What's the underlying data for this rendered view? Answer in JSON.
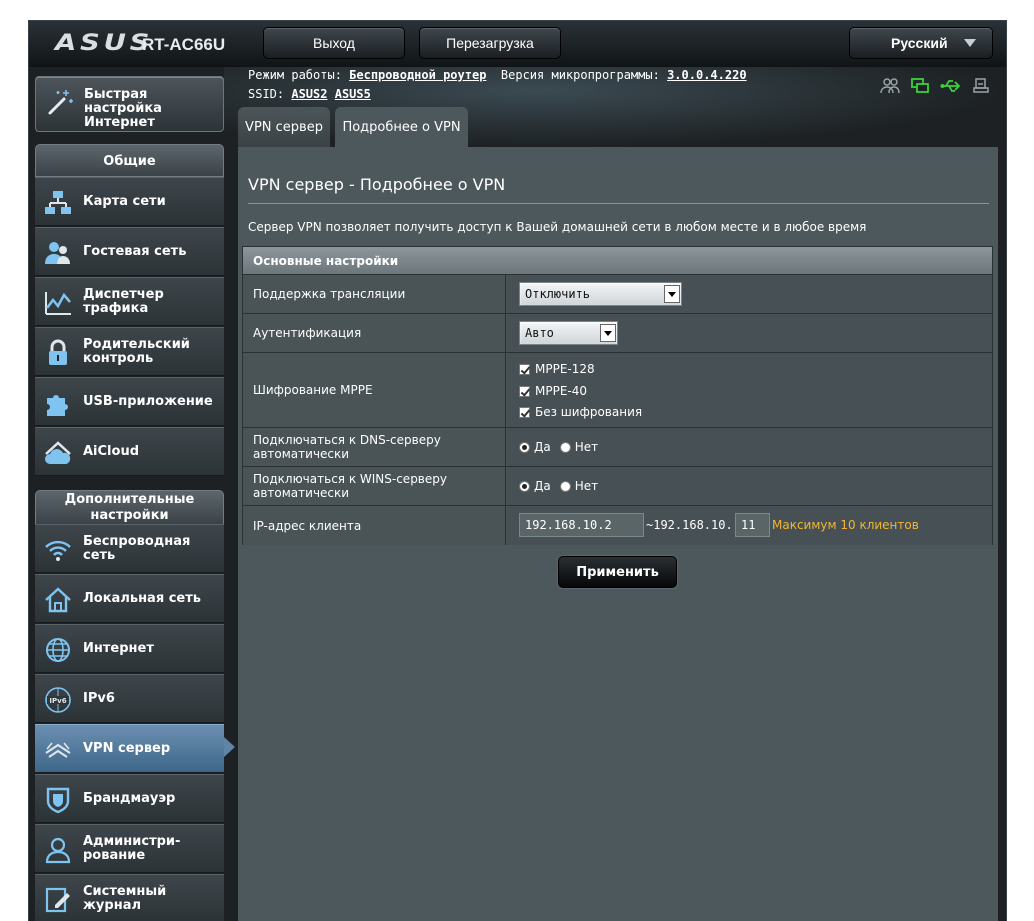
{
  "header": {
    "logo": "ASUS",
    "model": "RT-AC66U",
    "logout_label": "Выход",
    "reboot_label": "Перезагрузка",
    "language": "Русский"
  },
  "info": {
    "mode_label": "Режим работы:",
    "mode_value": "Беспроводной роутер",
    "fw_label": "Версия микропрограммы:",
    "fw_value": "3.0.0.4.220",
    "ssid_label": "SSID:",
    "ssid_1": "ASUS2",
    "ssid_2": "ASUS5"
  },
  "status_icons": [
    "clients-icon",
    "network-connected-icon",
    "usb-icon",
    "printer-icon"
  ],
  "sidebar": {
    "quick_setup": "Быстрая настройка Интернет",
    "general_header": "Общие",
    "general_items": [
      {
        "label": "Карта сети",
        "icon": "network-map-icon"
      },
      {
        "label": "Гостевая сеть",
        "icon": "guest-network-icon"
      },
      {
        "label": "Диспетчер трафика",
        "icon": "traffic-manager-icon"
      },
      {
        "label": "Родительский контроль",
        "icon": "parental-control-icon"
      },
      {
        "label": "USB-приложение",
        "icon": "usb-app-icon"
      },
      {
        "label": "AiCloud",
        "icon": "aicloud-icon"
      }
    ],
    "advanced_header": "Дополнительные настройки",
    "advanced_items": [
      {
        "label": "Беспроводная сеть",
        "icon": "wireless-icon"
      },
      {
        "label": "Локальная сеть",
        "icon": "lan-icon"
      },
      {
        "label": "Интернет",
        "icon": "globe-icon"
      },
      {
        "label": "IPv6",
        "icon": "ipv6-icon"
      },
      {
        "label": "VPN сервер",
        "icon": "vpn-icon"
      },
      {
        "label": "Брандмауэр",
        "icon": "firewall-icon"
      },
      {
        "label": "Администри-рование",
        "icon": "admin-icon"
      },
      {
        "label": "Системный журнал",
        "icon": "syslog-icon"
      }
    ],
    "active_item": "VPN сервер"
  },
  "tabs": [
    {
      "label": "VPN сервер",
      "active": false
    },
    {
      "label": "Подробнее о VPN",
      "active": true
    }
  ],
  "main": {
    "title": "VPN сервер - Подробнее о VPN",
    "description": "Сервер VPN позволяет получить доступ к Вашей домашней сети в любом месте и в любое время",
    "section_header": "Основные настройки",
    "broadcast_label": "Поддержка трансляции",
    "broadcast_value": "Отключить",
    "auth_label": "Аутентификация",
    "auth_value": "Авто",
    "mppe_label": "Шифрование MPPE",
    "mppe_options": [
      {
        "label": "MPPE-128",
        "checked": true
      },
      {
        "label": "MPPE-40",
        "checked": true
      },
      {
        "label": "Без шифрования",
        "checked": true
      }
    ],
    "dns_label": "Подключаться к DNS-серверу автоматически",
    "dns_yes": "Да",
    "dns_no": "Нет",
    "dns_value": "Да",
    "wins_label": "Подключаться к WINS-серверу автоматически",
    "wins_yes": "Да",
    "wins_no": "Нет",
    "wins_value": "Да",
    "ip_label": "IP-адрес клиента",
    "ip_start": "192.168.10.2",
    "ip_sep": "~192.168.10.",
    "ip_end": "11",
    "ip_hint": "Максимум 10 клиентов",
    "apply_label": "Применить"
  },
  "colors": {
    "accent_active": "#4f769a",
    "hint": "#f2b632",
    "icon_blue": "#7fc4f0",
    "status_green": "#3ad23a"
  }
}
